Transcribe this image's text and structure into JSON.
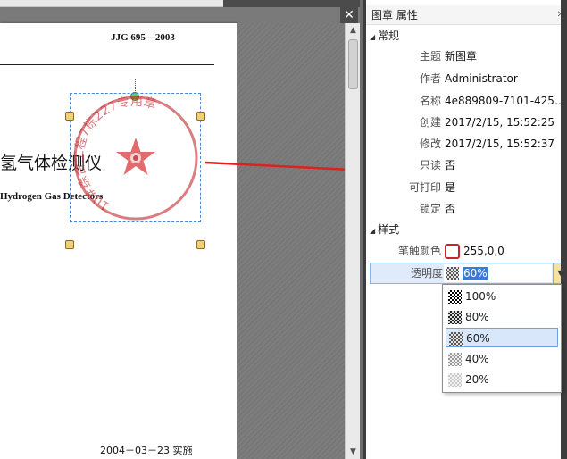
{
  "document": {
    "header": "JJG 695—2003",
    "title": "氢气体检测仪",
    "subtitle": "Hydrogen Gas Detectors",
    "footer_date": "2004－03－23 实施"
  },
  "stamp": {
    "ring_text": "10#综合工程7栋227专用章",
    "ink_color": "#c0282c"
  },
  "viewer": {
    "close_symbol": "✕"
  },
  "panel": {
    "title": "图章 属性",
    "pin_symbol": "✕",
    "section_general": "常规",
    "section_style": "样式",
    "general_rows": [
      {
        "key": "主题",
        "value": "新图章"
      },
      {
        "key": "作者",
        "value": "Administrator"
      },
      {
        "key": "名称",
        "value": "4e889809-7101-425c-…"
      },
      {
        "key": "创建",
        "value": "2017/2/15, 15:52:25"
      },
      {
        "key": "修改",
        "value": "2017/2/15, 15:52:37"
      },
      {
        "key": "只读",
        "value": "否"
      },
      {
        "key": "可打印",
        "value": "是"
      },
      {
        "key": "锁定",
        "value": "否"
      }
    ],
    "stroke_color_label": "笔触颜色",
    "stroke_color_value": "255,0,0",
    "opacity_label": "透明度",
    "opacity_value": "60%"
  },
  "opacity_options": [
    "100%",
    "80%",
    "60%",
    "40%",
    "20%"
  ],
  "opacity_selected": "60%"
}
